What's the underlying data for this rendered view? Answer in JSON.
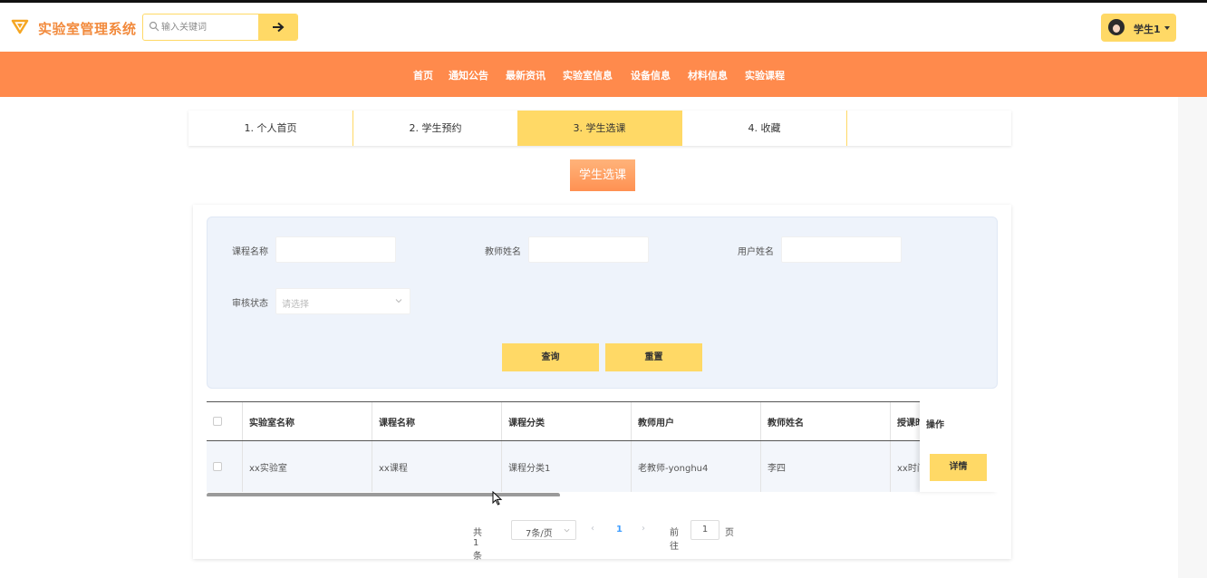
{
  "header": {
    "brand": "实验室管理系统",
    "search_placeholder": "输入关键词",
    "user_name": "学生1"
  },
  "nav": [
    "首页",
    "通知公告",
    "最新资讯",
    "实验室信息",
    "设备信息",
    "材料信息",
    "实验课程"
  ],
  "tabs": [
    "1. 个人首页",
    "2. 学生预约",
    "3. 学生选课",
    "4. 收藏"
  ],
  "active_tab": 2,
  "section_title": "学生选课",
  "filters": {
    "course_name_label": "课程名称",
    "teacher_name_label": "教师姓名",
    "user_name_label": "用户姓名",
    "status_label": "审核状态",
    "status_placeholder": "请选择",
    "query_button": "查询",
    "reset_button": "重置"
  },
  "table": {
    "columns": [
      "实验室名称",
      "课程名称",
      "课程分类",
      "教师用户",
      "教师姓名",
      "授课时",
      "操作"
    ],
    "rows": [
      [
        "xx实验室",
        "xx课程",
        "课程分类1",
        "老教师-yonghu4",
        "李四",
        "xx时间"
      ]
    ],
    "detail_button": "详情"
  },
  "pagination": {
    "total": "共 1 条",
    "page_size": "7条/页",
    "current_page": "1",
    "goto_label": "前往",
    "goto_value": "1",
    "page_unit": "页"
  },
  "colors": {
    "accent": "#ffd966",
    "nav_bg": "#ff8a4c",
    "brand_color": "#f28a3c"
  }
}
